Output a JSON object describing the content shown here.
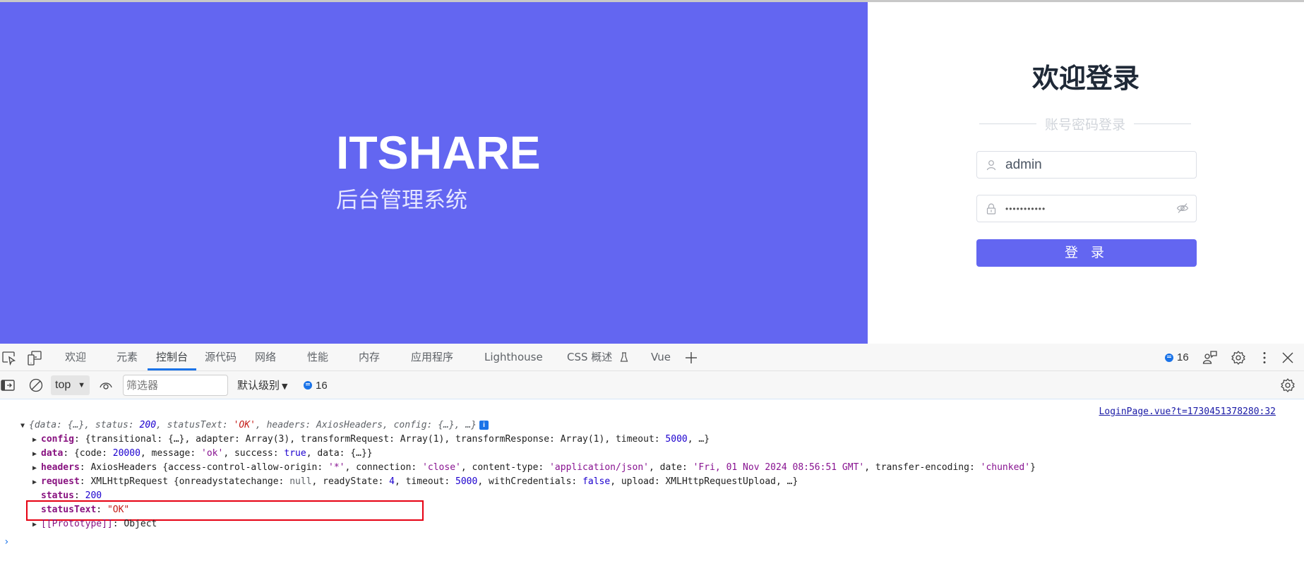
{
  "hero": {
    "brand": "ITSHARE",
    "subtitle": "后台管理系统",
    "bg_color": "#6366f1"
  },
  "login": {
    "title": "欢迎登录",
    "divider_text": "账号密码登录",
    "username": {
      "value": "admin",
      "icon": "user-icon"
    },
    "password": {
      "masked_value": "•••••••••••",
      "icon": "lock-icon",
      "toggle_icon": "eye-off-icon"
    },
    "submit_label": "登 录",
    "accent_color": "#6366f1"
  },
  "devtools": {
    "tabs": [
      {
        "label": "欢迎"
      },
      {
        "label": "元素"
      },
      {
        "label": "控制台",
        "active": true
      },
      {
        "label": "源代码"
      },
      {
        "label": "网络"
      },
      {
        "label": "性能"
      },
      {
        "label": "内存"
      },
      {
        "label": "应用程序"
      },
      {
        "label": "Lighthouse"
      },
      {
        "label": "CSS 概述"
      },
      {
        "label": "Vue"
      }
    ],
    "issues_count": "16",
    "toolbar": {
      "context": "top",
      "filter_placeholder": "筛选器",
      "level": "默认级别",
      "message_count": "16"
    },
    "console": {
      "source_link": "LoginPage.vue?t=1730451378280:32",
      "summary": {
        "p1": "{data: {…}, status: ",
        "status": "200",
        "p2": ", statusText: ",
        "statusText": "'OK'",
        "p3": ", headers: AxiosHeaders, config: {…}, …}",
        "info": "i"
      },
      "config": {
        "key": "config",
        "p1": ": {transitional: {…}, adapter: Array(3), transformRequest: Array(1), transformResponse: Array(1), timeout: ",
        "timeout": "5000",
        "p2": ", …}"
      },
      "data": {
        "key": "data",
        "p1": ": {code: ",
        "code": "20000",
        "p2": ", message: ",
        "message": "'ok'",
        "p3": ", success: ",
        "success": "true",
        "p4": ", data: {…}}"
      },
      "headers": {
        "key": "headers",
        "p1": ": AxiosHeaders {access-control-allow-origin: ",
        "origin": "'*'",
        "p2": ", connection: ",
        "connection": "'close'",
        "p3": ", content-type: ",
        "content_type": "'application/json'",
        "p4": ", date: ",
        "date": "'Fri, 01 Nov 2024 08:56:51 GMT'",
        "p5": ", transfer-encoding: ",
        "transfer_encoding": "'chunked'",
        "p6": "}"
      },
      "request": {
        "key": "request",
        "p1": ": XMLHttpRequest {onreadystatechange: ",
        "orsc": "null",
        "p2": ", readyState: ",
        "readyState": "4",
        "p3": ", timeout: ",
        "timeout": "5000",
        "p4": ", withCredentials: ",
        "withCredentials": "false",
        "p5": ", upload: XMLHttpRequestUpload, …}"
      },
      "status": {
        "key": "status",
        "sep": ": ",
        "value": "200"
      },
      "statusText": {
        "key": "statusText",
        "sep": ": ",
        "value": "\"OK\""
      },
      "prototype": {
        "key": "[[Prototype]]",
        "sep": ": ",
        "value": "Object"
      },
      "prompt": "›"
    }
  }
}
